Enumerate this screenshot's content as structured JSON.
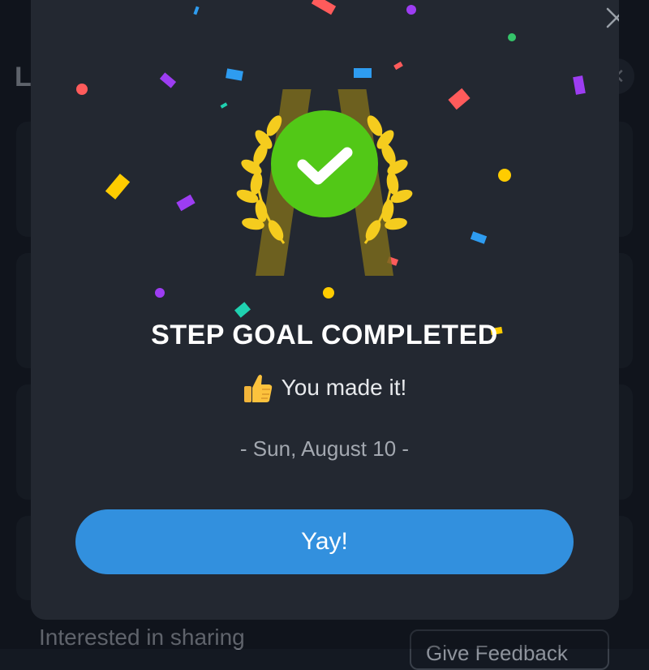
{
  "background": {
    "header_letter": "L",
    "footer_text": "Interested in sharing",
    "feedback_button_label": "Give Feedback"
  },
  "modal": {
    "close_icon": "close-icon",
    "badge_icon": "checkmark-laurel-icon",
    "title": "STEP GOAL COMPLETED",
    "subtitle_icon": "thumbs-up-icon",
    "subtitle": "You made it!",
    "date": "- Sun, August 10 -",
    "primary_button_label": "Yay!"
  },
  "colors": {
    "modal_bg": "#232831",
    "check_green": "#52c817",
    "laurel_gold": "#f5cc1e",
    "button_blue": "#3290de",
    "confetti": [
      "#ff5b5b",
      "#9d3df2",
      "#2e9cf0",
      "#ffcc00",
      "#1fd1b0",
      "#35c46a"
    ]
  }
}
